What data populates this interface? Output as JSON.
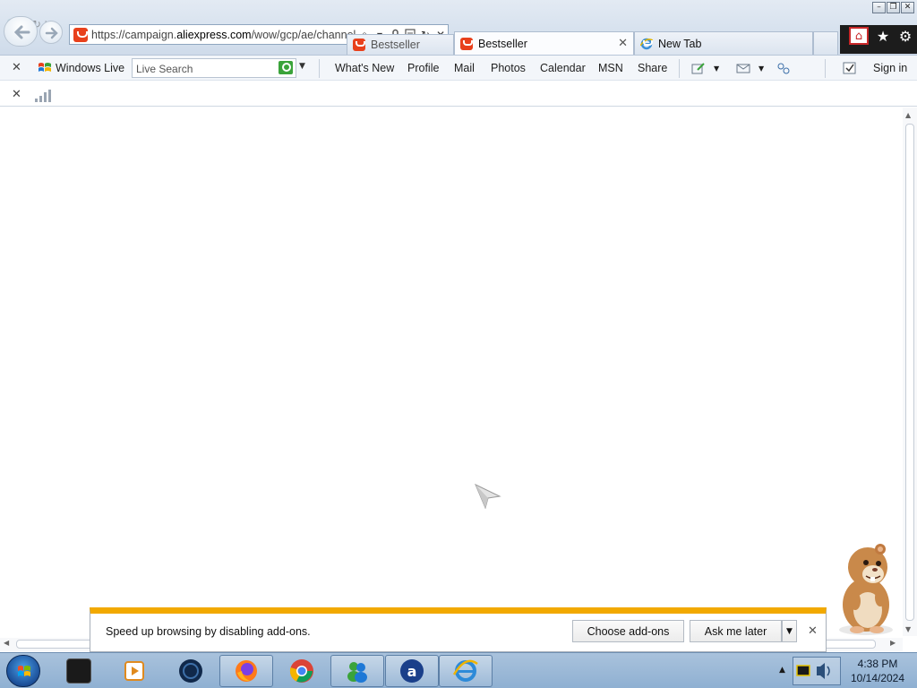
{
  "browser": {
    "url_prefix": "https://campaign.",
    "url_host": "aliexpress.com",
    "url_rest": "/wow/gcp/ae/channel/",
    "tabs": [
      {
        "label": "Bestseller",
        "state": "partially hidden"
      },
      {
        "label": "Bestseller",
        "state": "active"
      },
      {
        "label": "New Tab",
        "state": "inactive"
      }
    ]
  },
  "live_toolbar": {
    "brand": "Windows Live",
    "search_placeholder": "Live Search",
    "links": [
      "What's New",
      "Profile",
      "Mail",
      "Photos",
      "Calendar",
      "MSN",
      "Share"
    ],
    "sign_in": "Sign in"
  },
  "notification": {
    "message": "Speed up browsing by disabling add-ons.",
    "primary_button": "Choose add-ons",
    "secondary_button": "Ask me later"
  },
  "taskbar": {
    "time": "4:38 PM",
    "date": "10/14/2024"
  },
  "colors": {
    "notification_accent": "#f2a900",
    "aliexpress_red": "#e8401c",
    "taskbar": "#a9c2dc"
  }
}
